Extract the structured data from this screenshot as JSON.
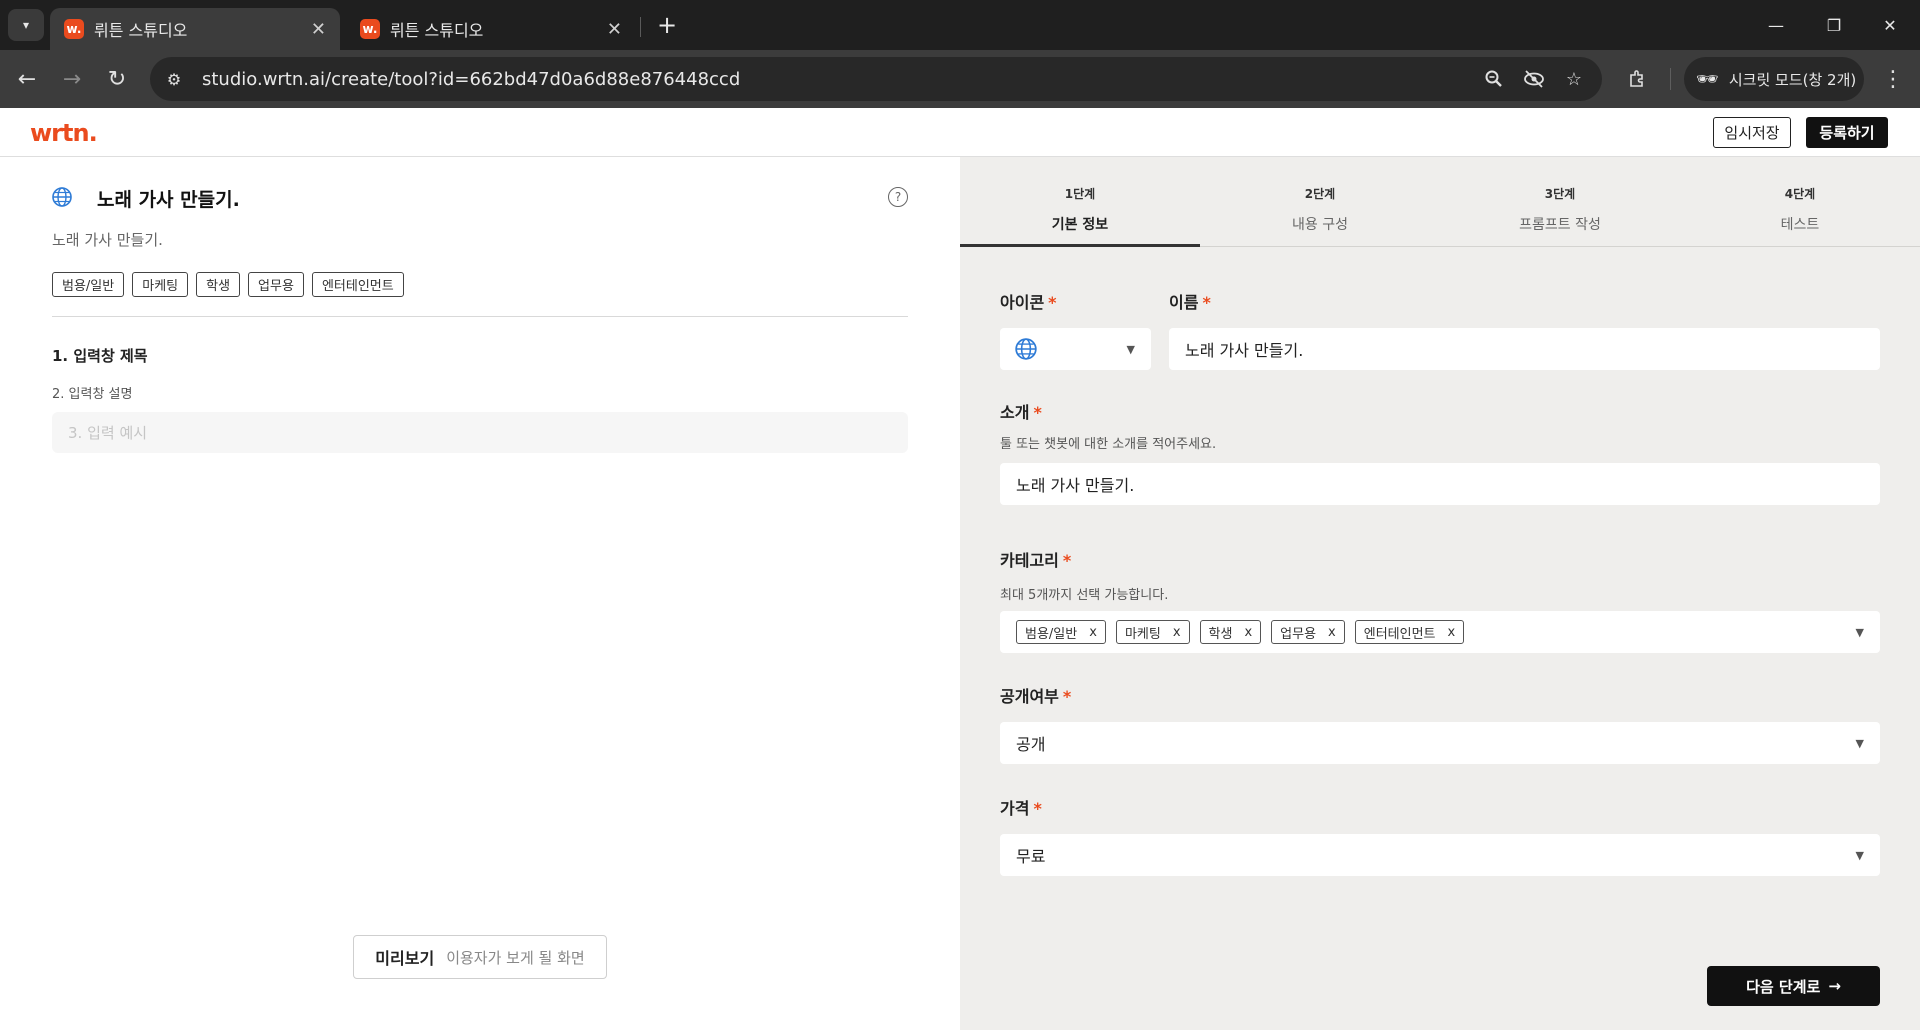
{
  "browser": {
    "tabs": [
      {
        "title": "뤼튼 스튜디오",
        "favicon": "w."
      },
      {
        "title": "뤼튼 스튜디오",
        "favicon": "w."
      }
    ],
    "url": "studio.wrtn.ai/create/tool?id=662bd47d0a6d88e876448ccd",
    "incognito_label": "시크릿 모드(창 2개)"
  },
  "header": {
    "logo": "wrtn.",
    "save_label": "임시저장",
    "register_label": "등록하기"
  },
  "preview": {
    "title": "노래 가사 만들기.",
    "description": "노래 가사 만들기.",
    "tags": [
      "범용/일반",
      "마케팅",
      "학생",
      "업무용",
      "엔터테인먼트"
    ],
    "input_title": "1. 입력창 제목",
    "input_description": "2. 입력창 설명",
    "input_example": "3. 입력 예시",
    "preview_button_strong": "미리보기",
    "preview_button_light": "이용자가 보게 될 화면"
  },
  "steps": [
    {
      "number": "1단계",
      "label": "기본 정보",
      "active": true
    },
    {
      "number": "2단계",
      "label": "내용 구성",
      "active": false
    },
    {
      "number": "3단계",
      "label": "프롬프트 작성",
      "active": false
    },
    {
      "number": "4단계",
      "label": "테스트",
      "active": false
    }
  ],
  "form": {
    "icon_label": "아이콘",
    "name_label": "이름",
    "name_value": "노래 가사 만들기.",
    "intro_label": "소개",
    "intro_help": "툴 또는 챗봇에 대한 소개를 적어주세요.",
    "intro_value": "노래 가사 만들기.",
    "category_label": "카테고리",
    "category_help": "최대 5개까지 선택 가능합니다.",
    "categories": [
      "범용/일반",
      "마케팅",
      "학생",
      "업무용",
      "엔터테인먼트"
    ],
    "chip_remove": "x",
    "visibility_label": "공개여부",
    "visibility_value": "공개",
    "price_label": "가격",
    "price_value": "무료",
    "required_mark": "*",
    "next_label": "다음 단계로"
  },
  "colors": {
    "brand": "#ea4b1e",
    "panel_bg": "#efeeec",
    "primary_button": "#111111",
    "globe": "#2e7bd6"
  }
}
